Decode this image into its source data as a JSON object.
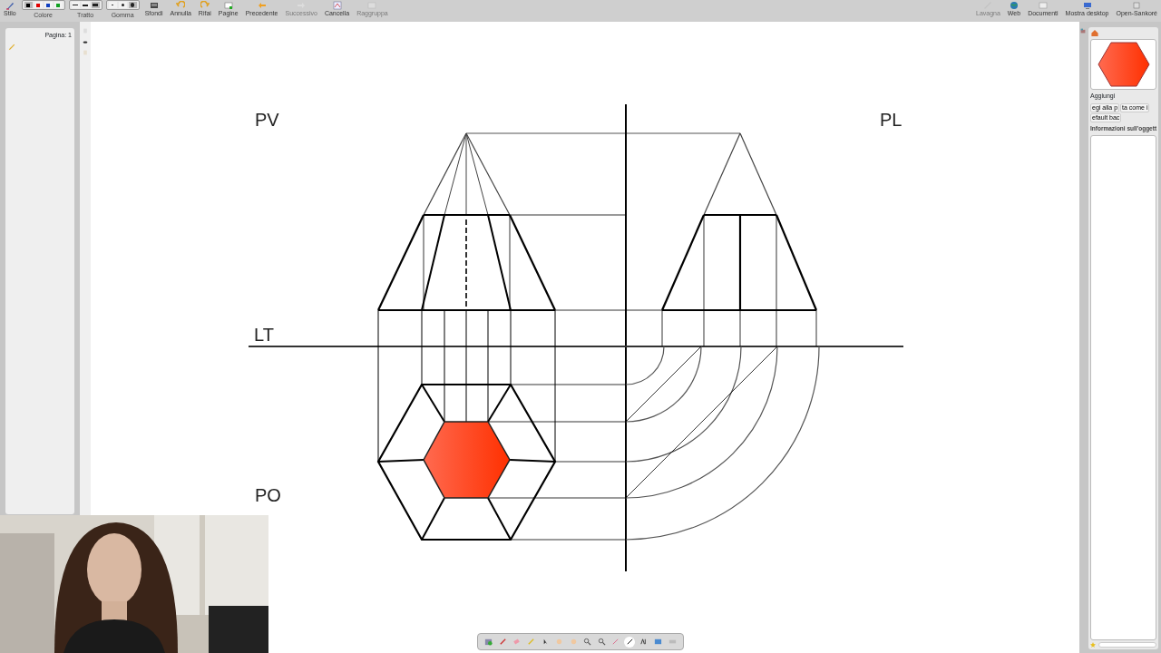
{
  "toolbar": {
    "items": [
      {
        "kind": "tool",
        "label": "Stilo",
        "disabled": false
      },
      {
        "kind": "colors",
        "label": "Colore",
        "options": [
          {
            "color": "#000000",
            "selected": true
          },
          {
            "color": "#e00000",
            "selected": false
          },
          {
            "color": "#1040c0",
            "selected": false
          },
          {
            "color": "#10a020",
            "selected": false
          }
        ]
      },
      {
        "kind": "sizes",
        "label": "Tratto",
        "options": [
          {
            "selected": false
          },
          {
            "selected": false
          },
          {
            "selected": true
          }
        ]
      },
      {
        "kind": "sizes",
        "label": "Gomma",
        "options": [
          {
            "selected": false
          },
          {
            "selected": false
          },
          {
            "selected": true
          }
        ]
      },
      {
        "kind": "tool",
        "label": "Sfondi",
        "disabled": false
      },
      {
        "kind": "tool",
        "label": "Annulla",
        "disabled": false
      },
      {
        "kind": "tool",
        "label": "Rifai",
        "disabled": false
      },
      {
        "kind": "tool",
        "label": "Pagine",
        "disabled": false
      },
      {
        "kind": "tool",
        "label": "Precedente",
        "disabled": false
      },
      {
        "kind": "tool",
        "label": "Successivo",
        "disabled": true
      },
      {
        "kind": "tool",
        "label": "Cancella",
        "disabled": false
      },
      {
        "kind": "tool",
        "label": "Raggruppa",
        "disabled": true
      }
    ],
    "modes": [
      {
        "label": "Lavagna",
        "selected": true
      },
      {
        "label": "Web",
        "selected": false
      },
      {
        "label": "Documenti",
        "selected": false
      },
      {
        "label": "Mostra desktop",
        "selected": false
      },
      {
        "label": "Open-Sankoré",
        "selected": false
      }
    ]
  },
  "pages_panel": {
    "thumbnail_label": "Pagina: 1"
  },
  "board": {
    "labels": [
      {
        "text": "PV"
      },
      {
        "text": "PL"
      },
      {
        "text": "LT"
      },
      {
        "text": "PO"
      }
    ]
  },
  "library_panel": {
    "section": "Aggiungi",
    "actions": [
      "egi alla p",
      "ta come i",
      "efault bac"
    ],
    "info_title": "Informazioni sull'oggett"
  },
  "floating_toolbar": {
    "tools": [
      {
        "selected": false
      },
      {
        "selected": false
      },
      {
        "selected": false
      },
      {
        "selected": false
      },
      {
        "selected": false
      },
      {
        "selected": false
      },
      {
        "selected": false
      },
      {
        "selected": false
      },
      {
        "selected": false
      },
      {
        "selected": false
      },
      {
        "selected": true
      },
      {
        "selected": false
      },
      {
        "selected": false
      },
      {
        "selected": false
      }
    ]
  }
}
